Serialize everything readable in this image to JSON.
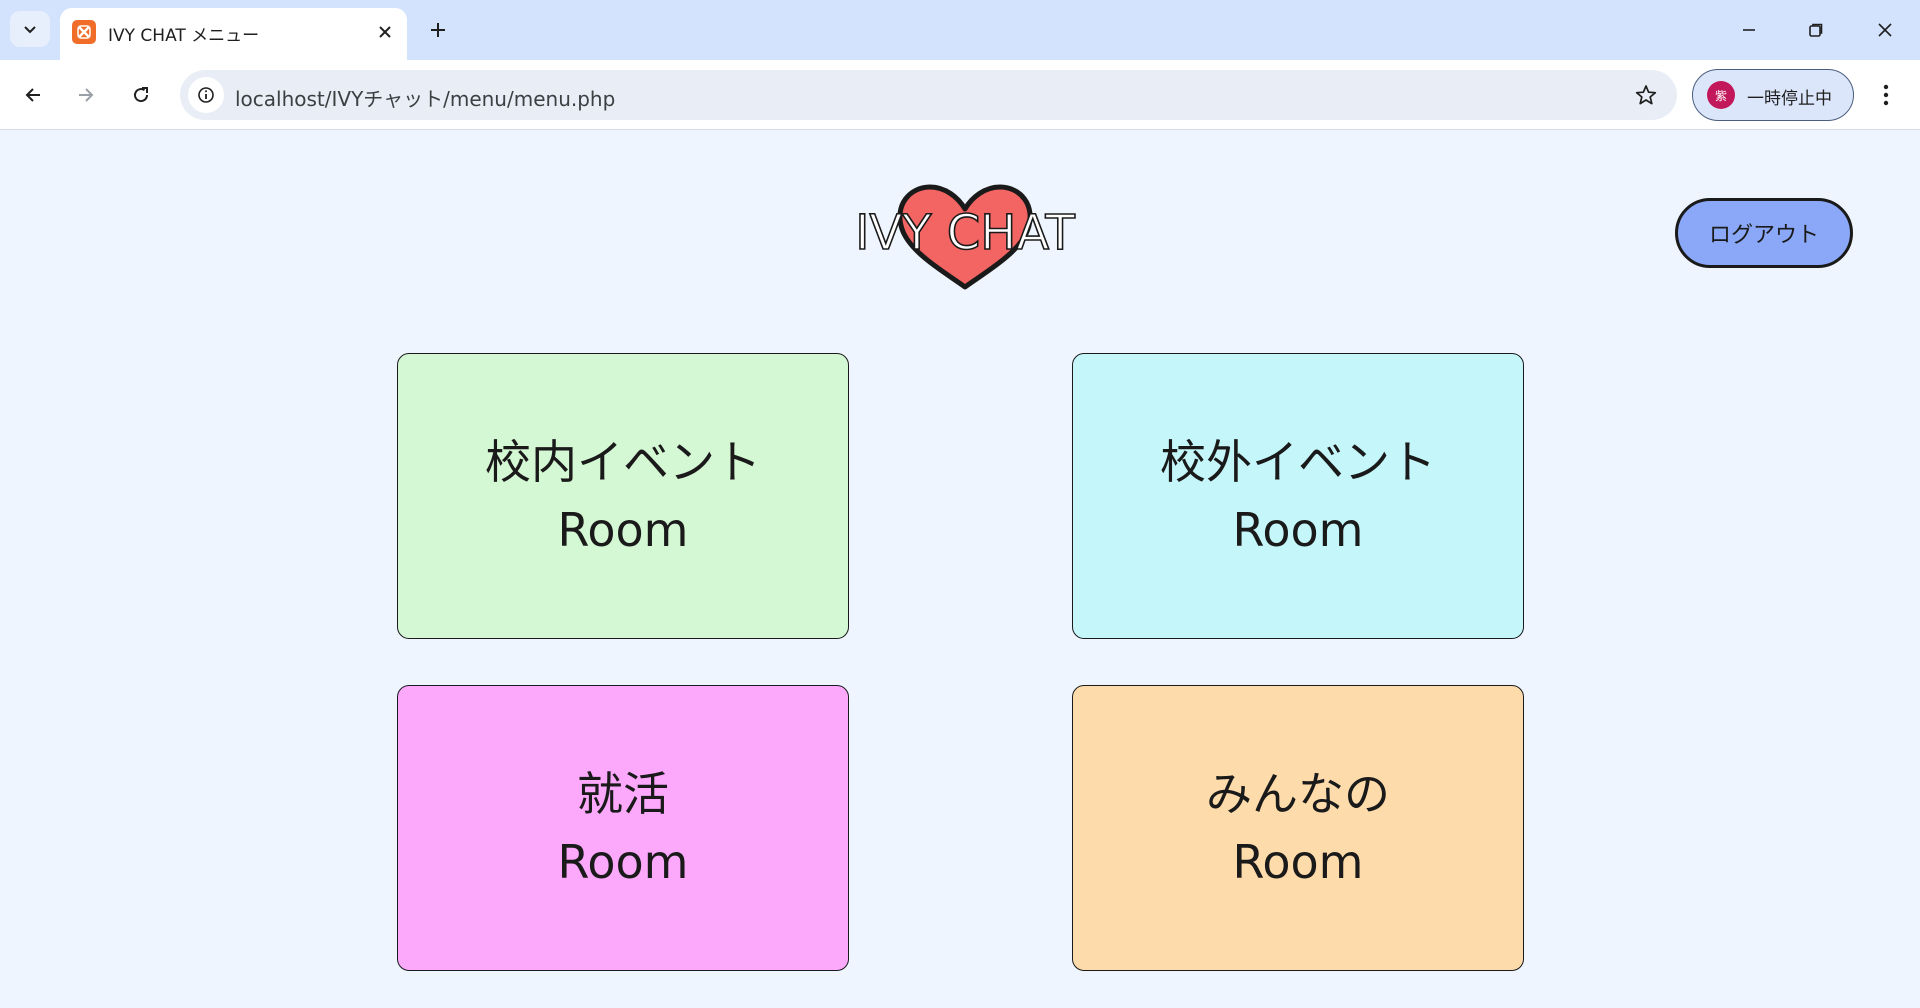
{
  "browser": {
    "tab": {
      "title": "IVY CHAT メニュー"
    },
    "url": "localhost/IVYチャット/menu/menu.php",
    "profile": {
      "avatar_char": "紫",
      "label": "一時停止中",
      "avatar_color": "#c2185b"
    }
  },
  "page": {
    "logo": {
      "text": "IVY CHAT",
      "heart_color": "#f26562"
    },
    "logout_label": "ログアウト",
    "logout_color": "#8aa8f7",
    "background": "#eef5fe",
    "rooms": [
      {
        "name": "校内イベント",
        "suffix": "Room",
        "color": "#d4f7d4"
      },
      {
        "name": "校外イベント",
        "suffix": "Room",
        "color": "#c4f6fa"
      },
      {
        "name": "就活",
        "suffix": "Room",
        "color": "#fca9fc"
      },
      {
        "name": "みんなの",
        "suffix": "Room",
        "color": "#fddbab"
      }
    ]
  }
}
